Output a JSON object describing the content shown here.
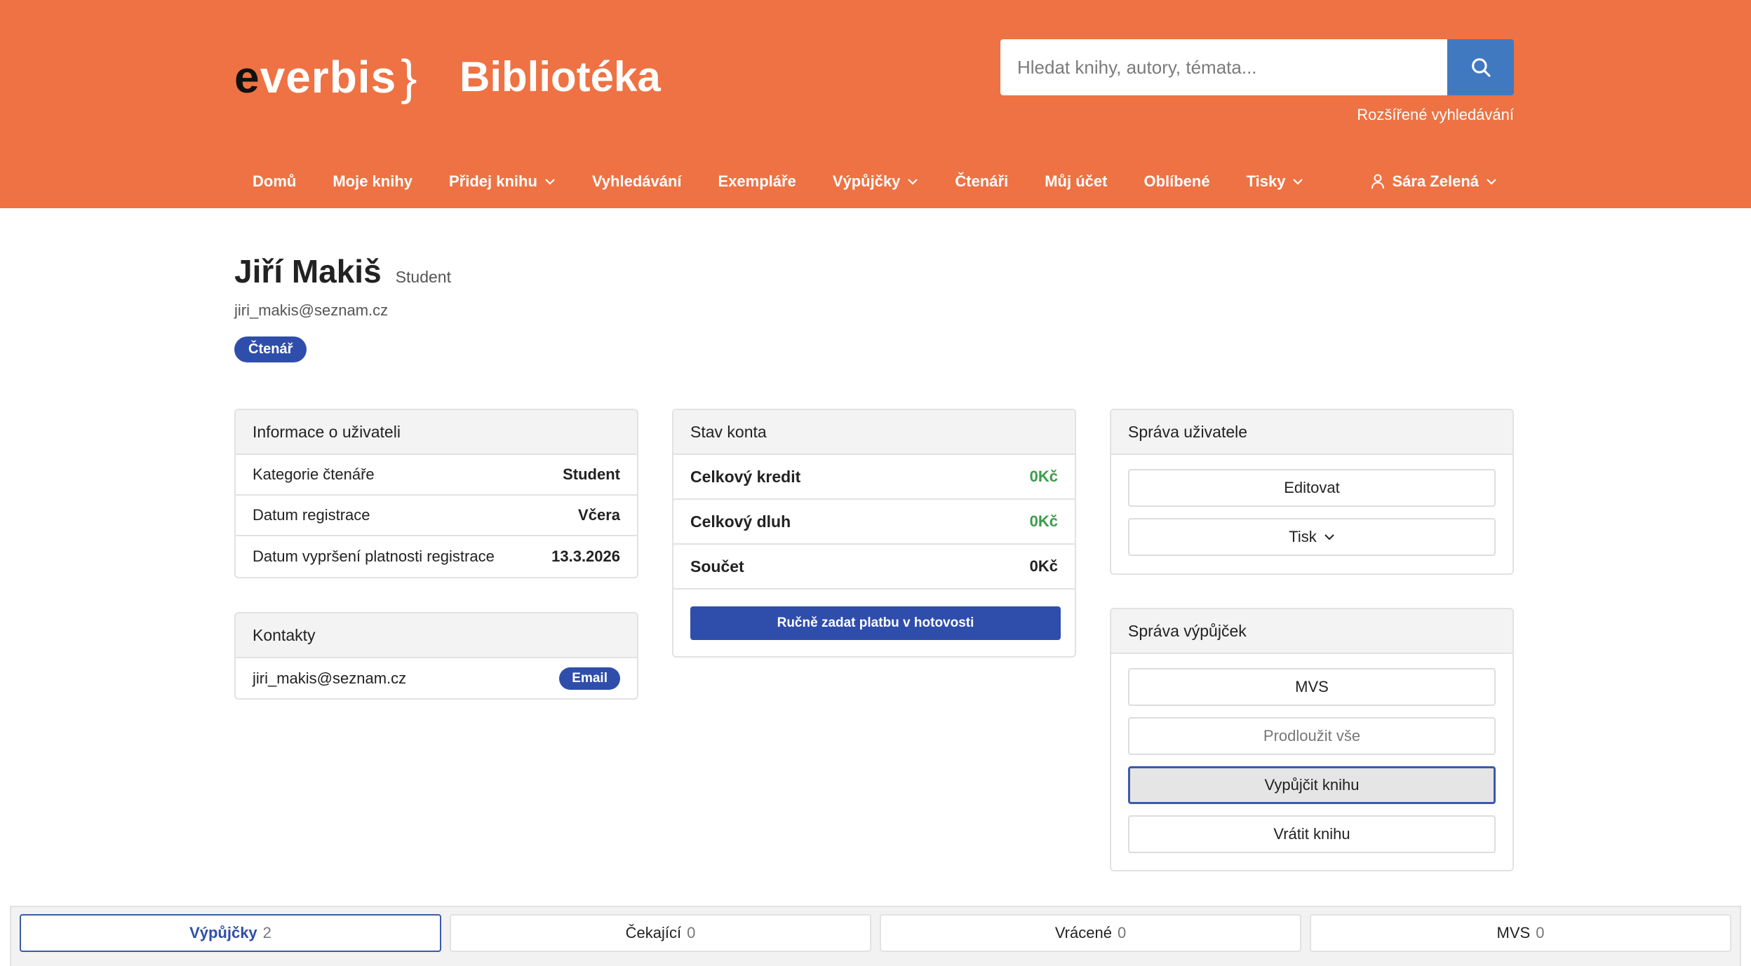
{
  "header": {
    "logo_e": "e",
    "logo_rest": "verbis",
    "logo_brace": "}",
    "title": "Bibliotéka",
    "search_placeholder": "Hledat knihy, autory, témata...",
    "advanced_search": "Rozšířené vyhledávání"
  },
  "nav": {
    "items": [
      {
        "label": "Domů"
      },
      {
        "label": "Moje knihy"
      },
      {
        "label": "Přidej knihu"
      },
      {
        "label": "Vyhledávání"
      },
      {
        "label": "Exempláře"
      },
      {
        "label": "Výpůjčky"
      },
      {
        "label": "Čtenáři"
      },
      {
        "label": "Můj účet"
      },
      {
        "label": "Oblíbené"
      },
      {
        "label": "Tisky"
      }
    ],
    "user": "Sára Zelená"
  },
  "profile": {
    "name": "Jiří Makiš",
    "category": "Student",
    "email": "jiri_makis@seznam.cz",
    "role": "Čtenář"
  },
  "info_card": {
    "title": "Informace o uživateli",
    "rows": [
      {
        "label": "Kategorie čtenáře",
        "value": "Student"
      },
      {
        "label": "Datum registrace",
        "value": "Včera"
      },
      {
        "label": "Datum vypršení platnosti registrace",
        "value": "13.3.2026"
      }
    ]
  },
  "contacts_card": {
    "title": "Kontakty",
    "email": "jiri_makis@seznam.cz",
    "badge": "Email"
  },
  "account_card": {
    "title": "Stav konta",
    "rows": [
      {
        "label": "Celkový kredit",
        "value": "0Kč"
      },
      {
        "label": "Celkový dluh",
        "value": "0Kč"
      },
      {
        "label": "Součet",
        "value": "0Kč"
      }
    ],
    "pay_button": "Ručně zadat platbu v hotovosti"
  },
  "user_mgmt_card": {
    "title": "Správa uživatele",
    "edit": "Editovat",
    "print": "Tisk"
  },
  "loans_mgmt_card": {
    "title": "Správa výpůjček",
    "mvs": "MVS",
    "extend_all": "Prodloužit vše",
    "borrow": "Vypůjčit knihu",
    "return": "Vrátit knihu"
  },
  "tabs": [
    {
      "label": "Výpůjčky",
      "count": "2"
    },
    {
      "label": "Čekající",
      "count": "0"
    },
    {
      "label": "Vrácené",
      "count": "0"
    },
    {
      "label": "MVS",
      "count": "0"
    }
  ],
  "colors": {
    "header_bg": "#ee7243",
    "primary": "#2f4eab",
    "search_button": "#4179c0",
    "positive": "#3a9d4a"
  }
}
